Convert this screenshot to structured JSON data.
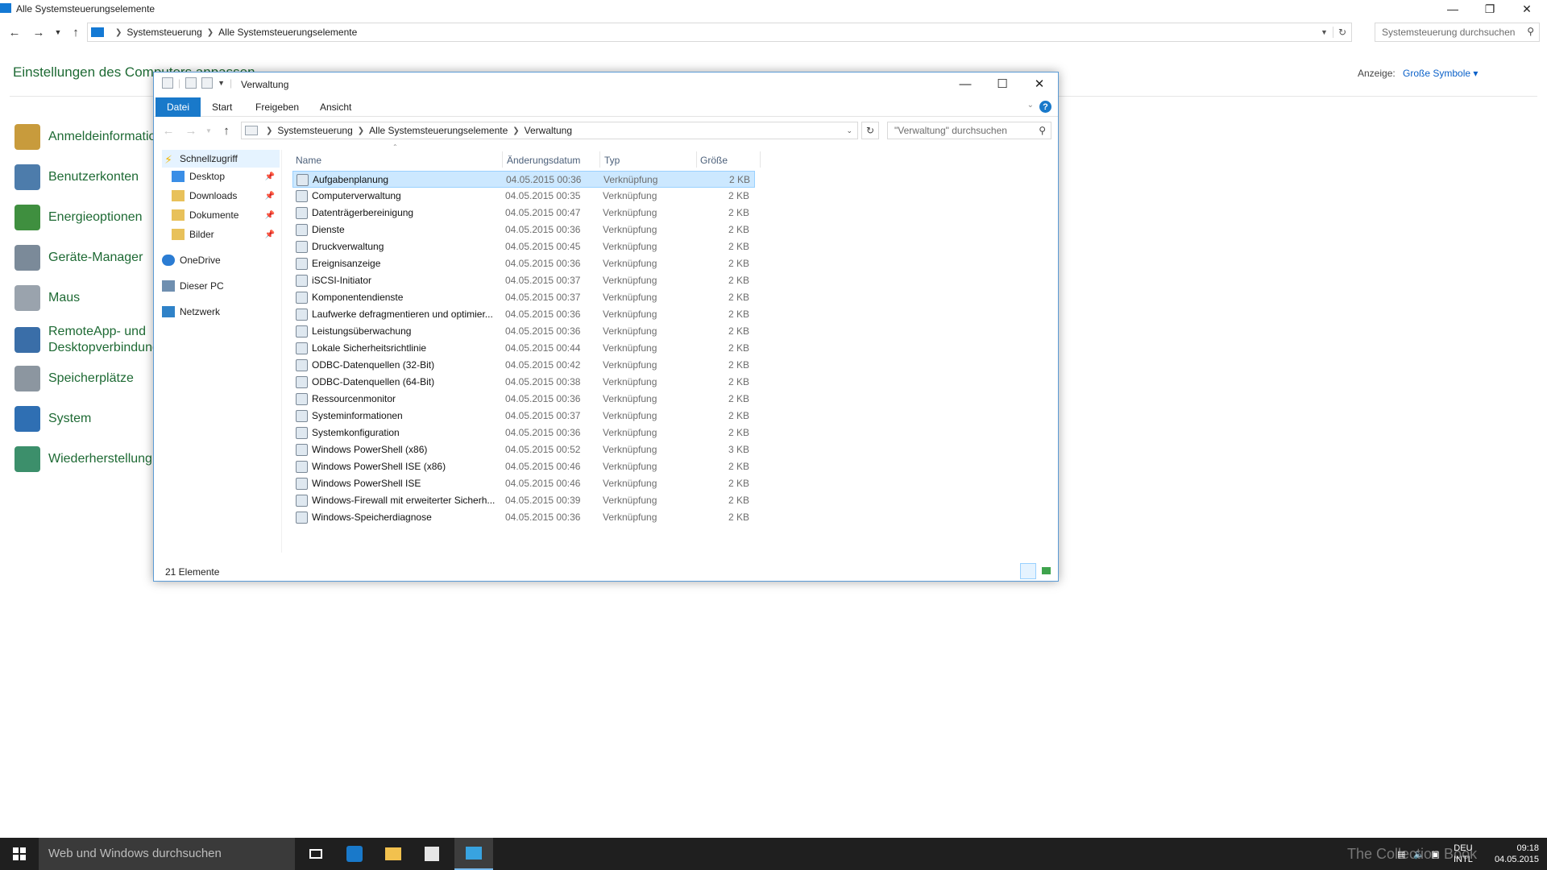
{
  "background": {
    "window_title": "Alle Systemsteuerungselemente",
    "breadcrumb": [
      "Systemsteuerung",
      "Alle Systemsteuerungselemente"
    ],
    "search_placeholder": "Systemsteuerung durchsuchen",
    "heading": "Einstellungen des Computers anpassen",
    "view_label": "Anzeige:",
    "view_value": "Große Symbole ▾",
    "items": [
      {
        "label": "Anmeldeinformationsverwaltung",
        "icon": "credential-manager-icon",
        "color": "#c89b3c"
      },
      {
        "label": "Benutzerkonten",
        "icon": "user-accounts-icon",
        "color": "#4d7cab"
      },
      {
        "label": "Energieoptionen",
        "icon": "power-options-icon",
        "color": "#3f8f3f"
      },
      {
        "label": "Geräte-Manager",
        "icon": "device-manager-icon",
        "color": "#7b8a99"
      },
      {
        "label": "Maus",
        "icon": "mouse-icon",
        "color": "#9aa3ad"
      },
      {
        "label": "RemoteApp- und Desktopverbindungen",
        "icon": "remoteapp-icon",
        "color": "#3a6ea8"
      },
      {
        "label": "Speicherplätze",
        "icon": "storage-spaces-icon",
        "color": "#8c96a0"
      },
      {
        "label": "System",
        "icon": "system-icon",
        "color": "#2f6fb3"
      },
      {
        "label": "Wiederherstellung",
        "icon": "recovery-icon",
        "color": "#3c8f6b"
      }
    ]
  },
  "explorer": {
    "title": "Verwaltung",
    "tabs": [
      "Datei",
      "Start",
      "Freigeben",
      "Ansicht"
    ],
    "breadcrumb": [
      "Systemsteuerung",
      "Alle Systemsteuerungselemente",
      "Verwaltung"
    ],
    "search_placeholder": "\"Verwaltung\" durchsuchen",
    "nav": [
      {
        "label": "Schnellzugriff",
        "icon": "star-icon",
        "pinned": false
      },
      {
        "label": "Desktop",
        "icon": "desktop-folder-icon",
        "pinned": true
      },
      {
        "label": "Downloads",
        "icon": "downloads-folder-icon",
        "pinned": true
      },
      {
        "label": "Dokumente",
        "icon": "documents-folder-icon",
        "pinned": true
      },
      {
        "label": "Bilder",
        "icon": "pictures-folder-icon",
        "pinned": true
      },
      {
        "label": "OneDrive",
        "icon": "onedrive-icon",
        "pinned": false
      },
      {
        "label": "Dieser PC",
        "icon": "this-pc-icon",
        "pinned": false
      },
      {
        "label": "Netzwerk",
        "icon": "network-icon",
        "pinned": false
      }
    ],
    "pin_glyph": "📌",
    "columns": {
      "name": "Name",
      "date": "Änderungsdatum",
      "type": "Typ",
      "size": "Größe"
    },
    "files": [
      {
        "name": "Aufgabenplanung",
        "date": "04.05.2015 00:36",
        "type": "Verknüpfung",
        "size": "2 KB"
      },
      {
        "name": "Computerverwaltung",
        "date": "04.05.2015 00:35",
        "type": "Verknüpfung",
        "size": "2 KB"
      },
      {
        "name": "Datenträgerbereinigung",
        "date": "04.05.2015 00:47",
        "type": "Verknüpfung",
        "size": "2 KB"
      },
      {
        "name": "Dienste",
        "date": "04.05.2015 00:36",
        "type": "Verknüpfung",
        "size": "2 KB"
      },
      {
        "name": "Druckverwaltung",
        "date": "04.05.2015 00:45",
        "type": "Verknüpfung",
        "size": "2 KB"
      },
      {
        "name": "Ereignisanzeige",
        "date": "04.05.2015 00:36",
        "type": "Verknüpfung",
        "size": "2 KB"
      },
      {
        "name": "iSCSI-Initiator",
        "date": "04.05.2015 00:37",
        "type": "Verknüpfung",
        "size": "2 KB"
      },
      {
        "name": "Komponentendienste",
        "date": "04.05.2015 00:37",
        "type": "Verknüpfung",
        "size": "2 KB"
      },
      {
        "name": "Laufwerke defragmentieren und optimier...",
        "date": "04.05.2015 00:36",
        "type": "Verknüpfung",
        "size": "2 KB"
      },
      {
        "name": "Leistungsüberwachung",
        "date": "04.05.2015 00:36",
        "type": "Verknüpfung",
        "size": "2 KB"
      },
      {
        "name": "Lokale Sicherheitsrichtlinie",
        "date": "04.05.2015 00:44",
        "type": "Verknüpfung",
        "size": "2 KB"
      },
      {
        "name": "ODBC-Datenquellen (32-Bit)",
        "date": "04.05.2015 00:42",
        "type": "Verknüpfung",
        "size": "2 KB"
      },
      {
        "name": "ODBC-Datenquellen (64-Bit)",
        "date": "04.05.2015 00:38",
        "type": "Verknüpfung",
        "size": "2 KB"
      },
      {
        "name": "Ressourcenmonitor",
        "date": "04.05.2015 00:36",
        "type": "Verknüpfung",
        "size": "2 KB"
      },
      {
        "name": "Systeminformationen",
        "date": "04.05.2015 00:37",
        "type": "Verknüpfung",
        "size": "2 KB"
      },
      {
        "name": "Systemkonfiguration",
        "date": "04.05.2015 00:36",
        "type": "Verknüpfung",
        "size": "2 KB"
      },
      {
        "name": "Windows PowerShell (x86)",
        "date": "04.05.2015 00:52",
        "type": "Verknüpfung",
        "size": "3 KB"
      },
      {
        "name": "Windows PowerShell ISE (x86)",
        "date": "04.05.2015 00:46",
        "type": "Verknüpfung",
        "size": "2 KB"
      },
      {
        "name": "Windows PowerShell ISE",
        "date": "04.05.2015 00:46",
        "type": "Verknüpfung",
        "size": "2 KB"
      },
      {
        "name": "Windows-Firewall mit erweiterter Sicherh...",
        "date": "04.05.2015 00:39",
        "type": "Verknüpfung",
        "size": "2 KB"
      },
      {
        "name": "Windows-Speicherdiagnose",
        "date": "04.05.2015 00:36",
        "type": "Verknüpfung",
        "size": "2 KB"
      }
    ],
    "selected_index": 0,
    "status": "21 Elemente"
  },
  "taskbar": {
    "search_placeholder": "Web und Windows durchsuchen",
    "language": "DEU",
    "layout": "INTL",
    "time": "09:18",
    "date": "04.05.2015",
    "watermark": "The Collection Book"
  },
  "colors": {
    "accent": "#1979ca",
    "link_green": "#1e6a34",
    "selection": "#cce8ff"
  }
}
